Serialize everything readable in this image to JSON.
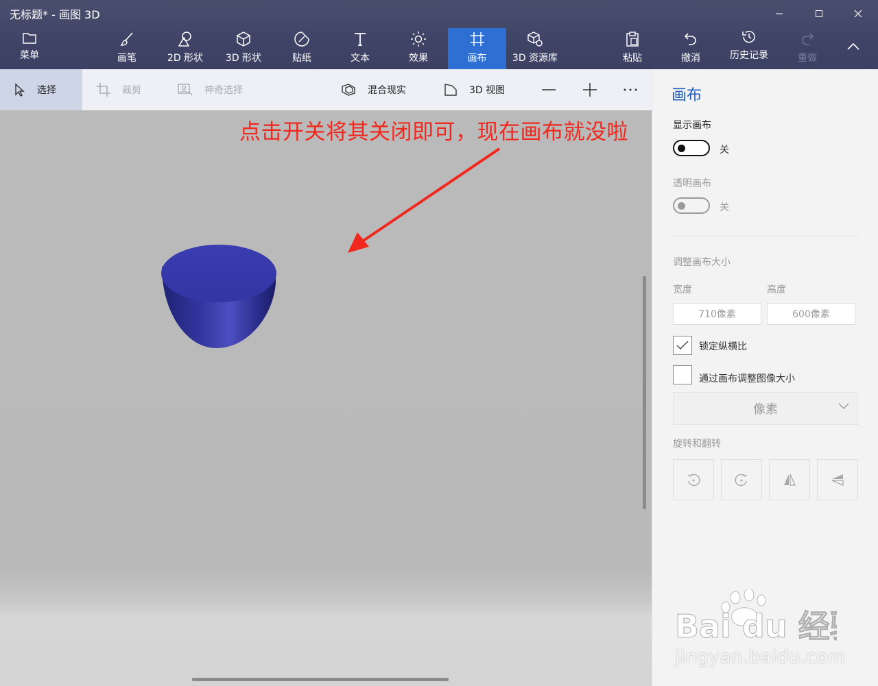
{
  "window": {
    "title": "无标题* - 画图 3D",
    "minimize_icon": "minimize-icon",
    "maximize_icon": "maximize-icon",
    "close_icon": "close-icon"
  },
  "ribbon": {
    "menu": "菜单",
    "brushes": "画笔",
    "shapes_2d": "2D 形状",
    "shapes_3d": "3D 形状",
    "stickers": "贴纸",
    "text": "文本",
    "effects": "效果",
    "canvas": "画布",
    "library_3d": "3D 资源库",
    "paste": "粘贴",
    "undo": "撤消",
    "history": "历史记录",
    "redo": "重做",
    "active_color": "#2d6fd2"
  },
  "subbar": {
    "select": "选择",
    "crop": "裁剪",
    "magic_select": "神奇选择",
    "mixed_reality": "混合现实",
    "view_3d": "3D 视图"
  },
  "canvas": {
    "annotation": "点击开关将其关闭即可，现在画布就没啦",
    "annotation_color": "#f0281d",
    "object_color": "#3a3da8"
  },
  "panel": {
    "title": "画布",
    "show_canvas_label": "显示画布",
    "show_canvas_state": "关",
    "transparent_canvas_label": "透明画布",
    "transparent_canvas_state": "关",
    "resize_label": "调整画布大小",
    "width_label": "宽度",
    "height_label": "高度",
    "width_value": "710像素",
    "height_value": "600像素",
    "lock_ratio_label": "锁定纵横比",
    "lock_ratio_checked": true,
    "resize_image_label": "通过画布调整图像大小",
    "resize_image_checked": false,
    "unit_selected": "像素",
    "rotate_flip_label": "旋转和翻转",
    "accent_color": "#1f5dbf"
  },
  "watermark": {
    "brand": "Bai du 经验",
    "url": "jingyan.baidu.com"
  }
}
